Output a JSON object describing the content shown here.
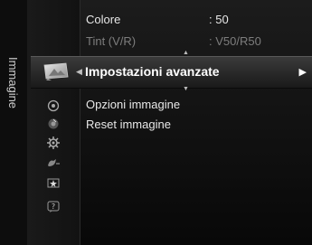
{
  "side_label": "Immagine",
  "items_above": [
    {
      "label": "Colore",
      "value": ": 50"
    },
    {
      "label": "Tint (V/R)",
      "value": ": V50/R50"
    }
  ],
  "highlighted": {
    "label": "Impostazioni avanzate"
  },
  "items_below": [
    {
      "label": "Opzioni immagine"
    },
    {
      "label": "Reset immagine"
    }
  ],
  "icons": [
    "picture-icon",
    "sound-icon",
    "channel-icon",
    "setup-icon",
    "input-icon",
    "application-icon",
    "support-icon"
  ],
  "colors": {
    "highlight": "#3b3b3b",
    "text": "#e8e8e8",
    "dim_text": "#7d7d7d"
  }
}
